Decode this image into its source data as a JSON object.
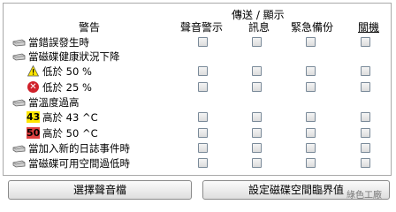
{
  "headers": {
    "group": "傳送 / 顯示",
    "warning": "警告",
    "sound": "聲音警示",
    "message": "訊息",
    "backup": "緊急備份",
    "shutdown": "關機"
  },
  "rows": [
    {
      "label": "當錯誤發生時",
      "icon": "drive-icon"
    },
    {
      "label": "當磁碟健康狀況下降",
      "icon": "drive-icon"
    },
    {
      "label": "低於 50 %",
      "icon": "warning-icon"
    },
    {
      "label": "低於 25 %",
      "icon": "error-icon"
    },
    {
      "label": "當溫度過高",
      "icon": "drive-icon"
    },
    {
      "label": "高於 43 ^C",
      "icon": "temp-43-icon",
      "icon_text": "43"
    },
    {
      "label": "高於 50 ^C",
      "icon": "temp-50-icon",
      "icon_text": "50"
    },
    {
      "label": "當加入新的日誌事件時",
      "icon": "drive-icon"
    },
    {
      "label": "當磁碟可用空間過低時",
      "icon": "drive-icon"
    }
  ],
  "buttons": {
    "select_sound": "選擇聲音檔",
    "set_threshold": "設定磁碟空間臨界值"
  },
  "watermark": "綠色工廠",
  "colors": {
    "warning_yellow": "#ffe600",
    "error_red": "#d0202a",
    "temp50_red": "#e04040"
  }
}
